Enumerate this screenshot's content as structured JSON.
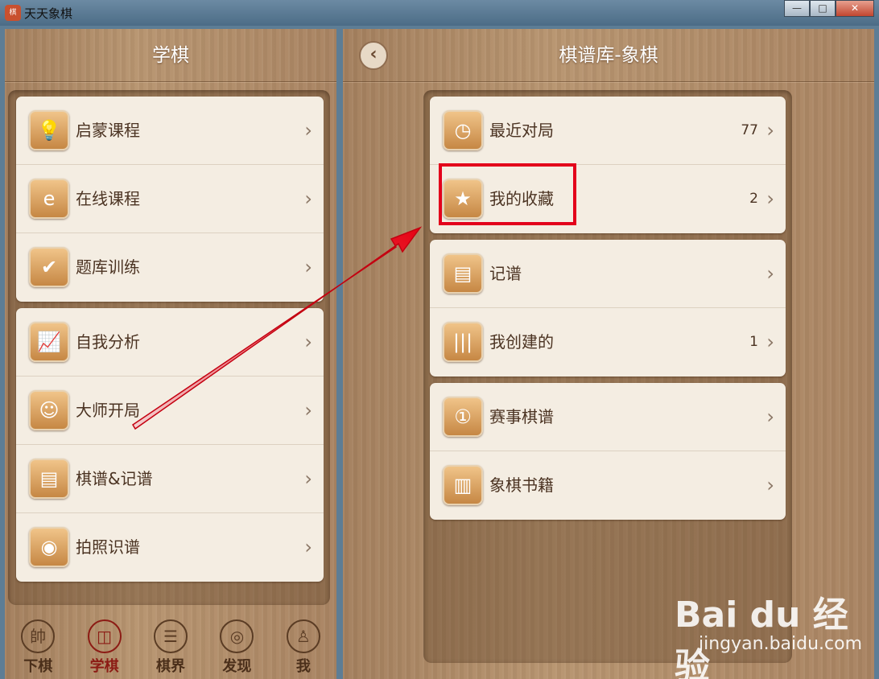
{
  "window": {
    "title": "天天象棋",
    "min": "—",
    "max": "□",
    "close": "✕"
  },
  "left_panel": {
    "title": "学棋",
    "groups": [
      [
        {
          "label": "启蒙课程",
          "icon": "bulb-icon"
        },
        {
          "label": "在线课程",
          "icon": "ie-icon"
        },
        {
          "label": "题库训练",
          "icon": "checklist-icon"
        }
      ],
      [
        {
          "label": "自我分析",
          "icon": "chart-icon"
        },
        {
          "label": "大师开局",
          "icon": "master-face-icon"
        },
        {
          "label": "棋谱&记谱",
          "icon": "notebook-icon"
        },
        {
          "label": "拍照识谱",
          "icon": "camera-icon"
        }
      ]
    ]
  },
  "right_panel": {
    "title": "棋谱库-象棋",
    "groups": [
      [
        {
          "label": "最近对局",
          "count": "77",
          "icon": "clock-icon"
        },
        {
          "label": "我的收藏",
          "count": "2",
          "icon": "star-badge-icon"
        }
      ],
      [
        {
          "label": "记谱",
          "count": "",
          "icon": "notebook-icon"
        },
        {
          "label": "我创建的",
          "count": "1",
          "icon": "barcode-icon"
        }
      ],
      [
        {
          "label": "赛事棋谱",
          "count": "",
          "icon": "medal-icon"
        },
        {
          "label": "象棋书籍",
          "count": "",
          "icon": "book-icon"
        }
      ]
    ]
  },
  "bottom_nav": [
    {
      "label": "下棋",
      "glyph": "帥",
      "active": false
    },
    {
      "label": "学棋",
      "glyph": "◫",
      "active": true
    },
    {
      "label": "棋界",
      "glyph": "☰",
      "active": false
    },
    {
      "label": "发现",
      "glyph": "◎",
      "active": false
    },
    {
      "label": "我",
      "glyph": "♙",
      "active": false
    }
  ],
  "watermark": {
    "logo": "Bai du 经验",
    "sub": "jingyan.baidu.com"
  },
  "colors": {
    "highlight": "#e3001b",
    "active_nav": "#8c1b14"
  }
}
